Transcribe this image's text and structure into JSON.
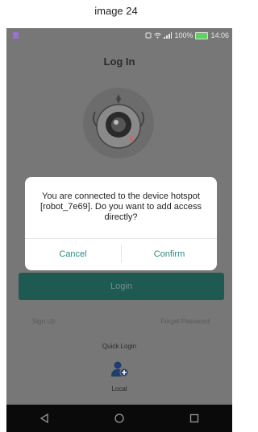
{
  "caption": "image 24",
  "status_bar": {
    "battery": "100%",
    "time": "14:06"
  },
  "header": {
    "title": "Log In"
  },
  "login_button": "Login",
  "links": {
    "sign_up": "Sign Up",
    "forget_password": "Forget Password"
  },
  "quick_login": {
    "label": "Quick Login",
    "local_label": "Local",
    "local_icon": "user-add-icon"
  },
  "dialog": {
    "message": "You are connected to the device hotspot [robot_7e69]. Do you want to add access directly?",
    "cancel": "Cancel",
    "confirm": "Confirm"
  },
  "nav": {
    "back_icon": "back-triangle-icon",
    "home_icon": "home-circle-icon",
    "recent_icon": "recent-square-icon"
  },
  "colors": {
    "accent": "#2a8a83",
    "login_button": "#1f5a52",
    "overlay": "#777777"
  }
}
